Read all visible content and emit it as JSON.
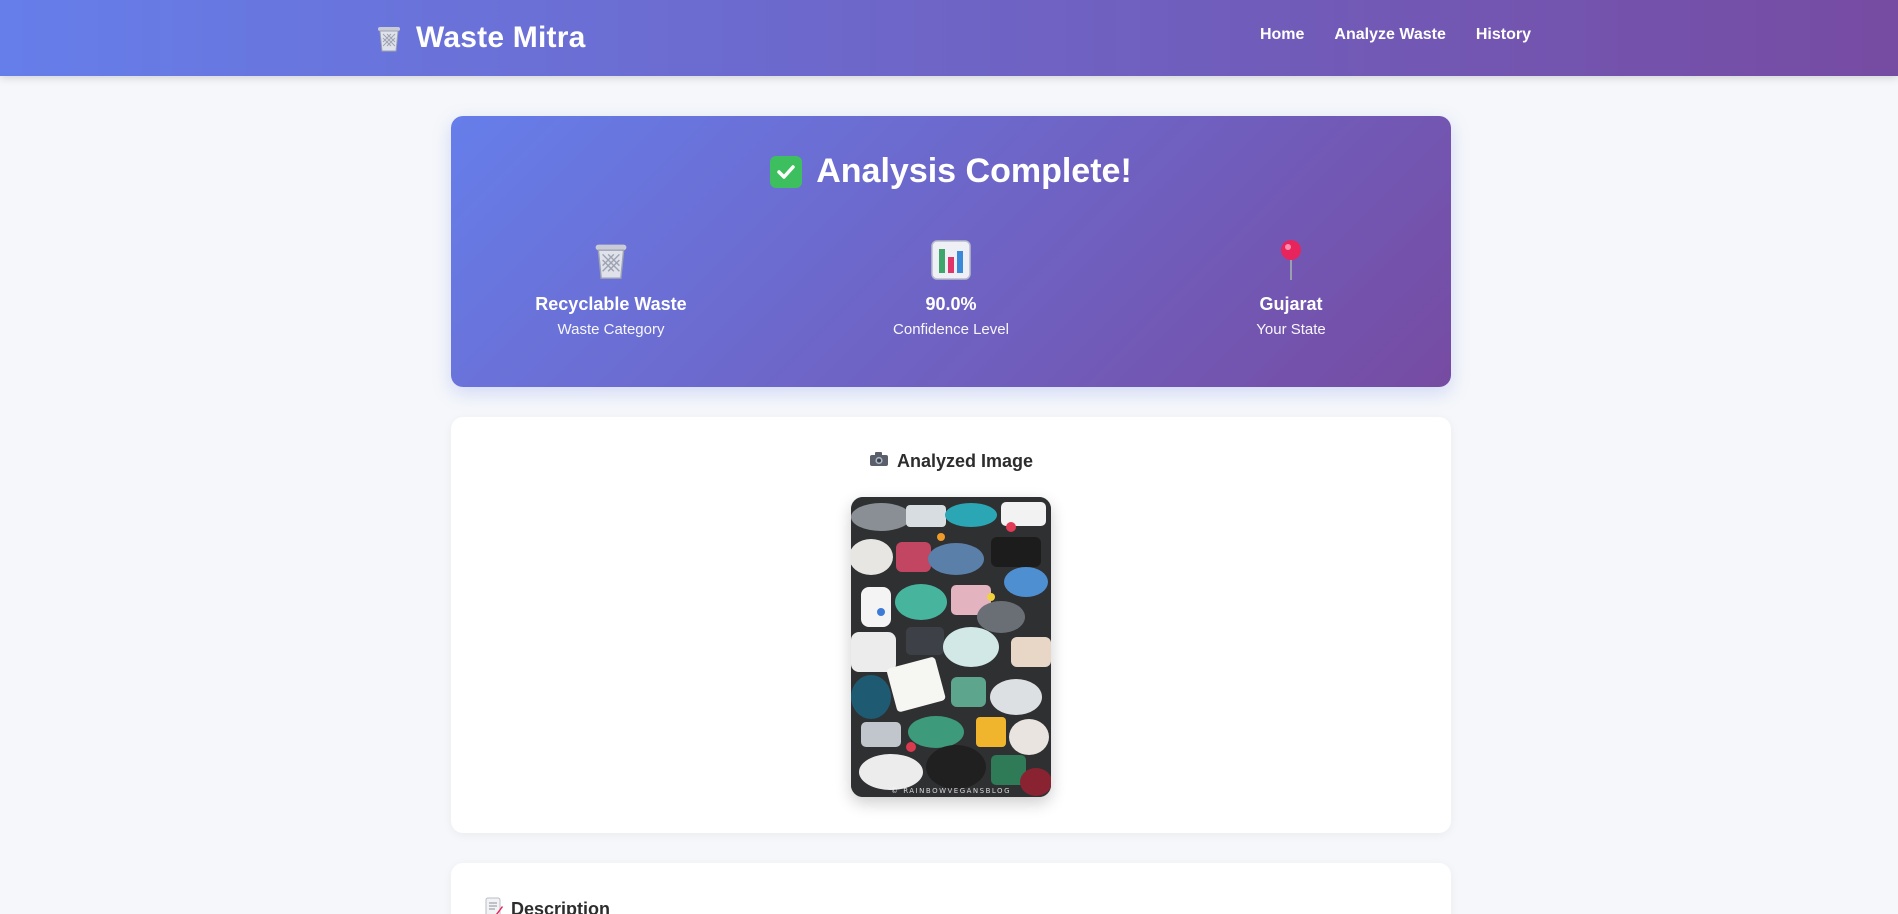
{
  "header": {
    "brand": "Waste Mitra",
    "brand_icon": "trash-bin-icon",
    "nav": [
      {
        "label": "Home"
      },
      {
        "label": "Analyze Waste"
      },
      {
        "label": "History"
      }
    ]
  },
  "result": {
    "title": "Analysis Complete!",
    "title_icon": "check-mark-icon",
    "stats": [
      {
        "icon": "trash-bin-icon",
        "value": "Recyclable Waste",
        "label": "Waste Category"
      },
      {
        "icon": "bar-chart-icon",
        "value": "90.0%",
        "label": "Confidence Level"
      },
      {
        "icon": "pushpin-icon",
        "value": "Gujarat",
        "label": "Your State"
      }
    ]
  },
  "image_section": {
    "title": "Analyzed Image",
    "title_icon": "camera-icon",
    "watermark": "© RAINBOWVEGANSBLOG"
  },
  "description_section": {
    "title": "Description",
    "title_icon": "memo-icon"
  },
  "colors": {
    "gradient_start": "#667eea",
    "gradient_end": "#764ba2",
    "page_bg": "#f5f7fa",
    "check_green": "#3dbf5f"
  }
}
